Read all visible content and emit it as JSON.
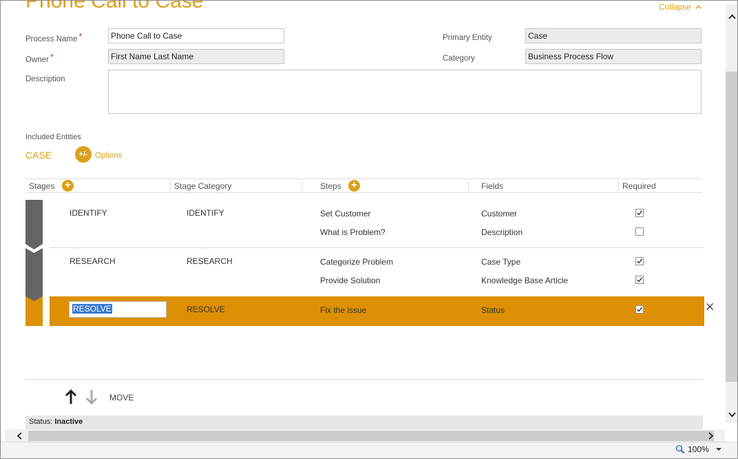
{
  "header": {
    "title": "Phone Call to Case",
    "collapse_label": "Collapse"
  },
  "form": {
    "process_name_label": "Process Name",
    "process_name_value": "Phone Call to Case",
    "owner_label": "Owner",
    "owner_value": "First Name Last Name",
    "description_label": "Description",
    "description_value": "",
    "required_marker": "*",
    "primary_entity_label": "Primary Entity",
    "primary_entity_value": "Case",
    "category_label": "Category",
    "category_value": "Business Process Flow"
  },
  "entities": {
    "heading": "Included Entities",
    "entity_name": "CASE",
    "options_icon_text": "+/-",
    "options_label": "Options"
  },
  "grid": {
    "columns": {
      "stages": "Stages",
      "stage_category": "Stage Category",
      "steps": "Steps",
      "fields": "Fields",
      "required": "Required"
    },
    "add_symbol": "+",
    "stages": [
      {
        "name": "IDENTIFY",
        "category": "IDENTIFY",
        "steps": [
          {
            "step": "Set Customer",
            "field": "Customer",
            "required": true
          },
          {
            "step": "What is Problem?",
            "field": "Description",
            "required": false
          }
        ]
      },
      {
        "name": "RESEARCH",
        "category": "RESEARCH",
        "steps": [
          {
            "step": "Categorize Problem",
            "field": "Case Type",
            "required": true
          },
          {
            "step": "Provide Solution",
            "field": "Knowledge Base Article",
            "required": true
          }
        ]
      },
      {
        "name": "RESOLVE",
        "category": "RESOLVE",
        "selected": true,
        "steps": [
          {
            "step": "Fix the issue",
            "field": "Status",
            "required": true
          }
        ]
      }
    ],
    "delete_symbol": "✕"
  },
  "move": {
    "label": "MOVE"
  },
  "status": {
    "label": "Status:",
    "value": "Inactive"
  },
  "zoom": {
    "value": "100%"
  },
  "colors": {
    "accent": "#dba11d",
    "selected_row": "#dd9004",
    "stage_chevron": "#646464",
    "selection_highlight": "#3a79d0"
  }
}
